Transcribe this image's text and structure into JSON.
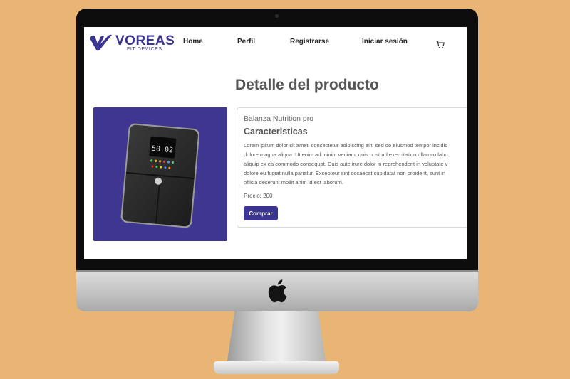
{
  "colors": {
    "background": "#e8b574",
    "brand": "#3b3592",
    "product_image_bg": "#3f3691"
  },
  "logo": {
    "name": "VOREAS",
    "tagline": "FIT DEVICES",
    "icon": "hand-swoosh-icon"
  },
  "nav": {
    "items": [
      {
        "label": "Home"
      },
      {
        "label": "Perfil"
      },
      {
        "label": "Registrarse"
      },
      {
        "label": "Iniciar sesión"
      }
    ],
    "cart_icon": "cart-icon"
  },
  "page": {
    "title": "Detalle del producto"
  },
  "product": {
    "image_icon": "smart-scale-image",
    "scale_display": "50.02",
    "name": "Balanza Nutrition pro",
    "features_heading": "Caracteristicas",
    "description_lines": [
      "Lorem ipsum dolor sit amet, consectetur adipiscing elit, sed do eiusmod tempor incidid",
      "dolore magna aliqua. Ut enim ad minim veniam, quis nostrud exercitation ullamco labo",
      "aliquip ex ea commodo consequat. Duis aute irure dolor in reprehenderit in voluptate v",
      "dolore eu fugiat nulla pariatur. Excepteur sint occaecat cupidatat non proident, sunt in",
      "officia deserunt mollit anim id est laborum."
    ],
    "price_text": "Precio: 200",
    "buy_label": "Comprar"
  },
  "device": {
    "brand_icon": "apple-logo-icon"
  }
}
